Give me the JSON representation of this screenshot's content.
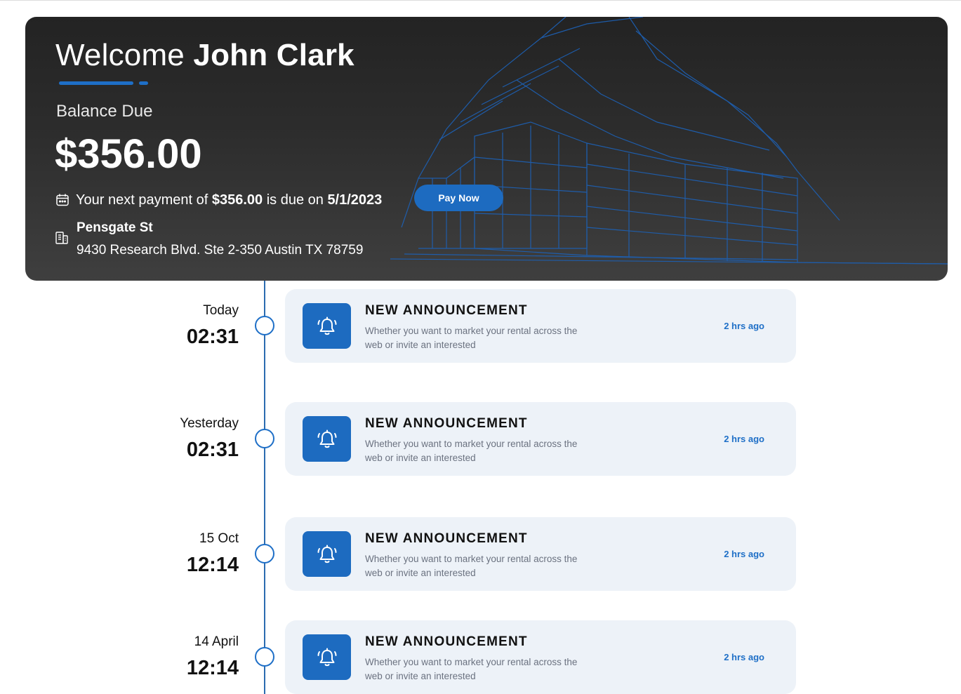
{
  "header": {
    "welcome_prefix": "Welcome",
    "user_name": "John Clark",
    "balance_label": "Balance Due",
    "balance_amount": "$356.00",
    "next_payment_prefix": "Your next payment of",
    "next_payment_amount": "$356.00",
    "next_payment_mid": "is due on",
    "next_payment_date": "5/1/2023",
    "pay_button_label": "Pay Now",
    "property_name": "Pensgate St",
    "property_address": "9430 Research Blvd. Ste 2-350 Austin TX 78759",
    "calendar_icon": "calendar-icon",
    "building_icon": "building-icon"
  },
  "colors": {
    "accent": "#1d6bc0",
    "hero_background": "#2b2b2b",
    "card_background": "#edf2f8",
    "timeline": "#2b6cb0"
  },
  "timeline": [
    {
      "day": "Today",
      "time": "02:31",
      "title": "NEW ANNOUNCEMENT",
      "description": "Whether you want to market your rental across the web or invite an interested",
      "ago": "2 hrs ago",
      "icon": "bell-icon"
    },
    {
      "day": "Yesterday",
      "time": "02:31",
      "title": "NEW ANNOUNCEMENT",
      "description": "Whether you want to market your rental across the web or invite an interested",
      "ago": "2 hrs ago",
      "icon": "bell-icon"
    },
    {
      "day": "15 Oct",
      "time": "12:14",
      "title": "NEW ANNOUNCEMENT",
      "description": "Whether you want to market your rental across the web or invite an interested",
      "ago": "2 hrs ago",
      "icon": "bell-icon"
    },
    {
      "day": "14 April",
      "time": "12:14",
      "title": "NEW ANNOUNCEMENT",
      "description": "Whether you want to market your rental across the web or invite an interested",
      "ago": "2 hrs ago",
      "icon": "bell-icon"
    }
  ]
}
